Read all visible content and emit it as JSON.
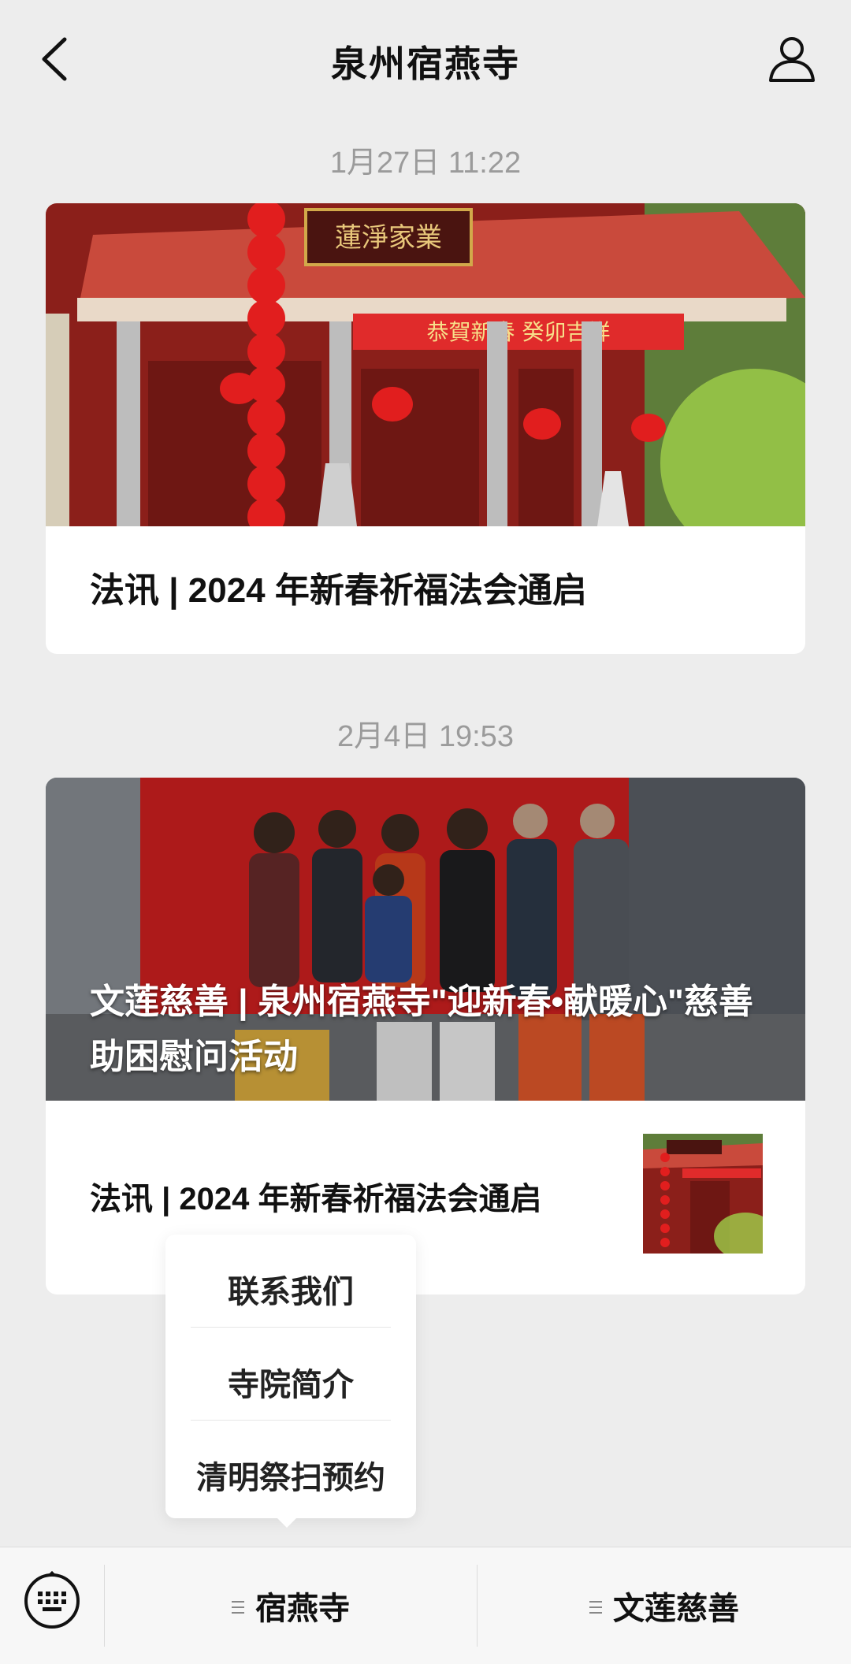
{
  "header": {
    "title": "泉州宿燕寺"
  },
  "messages": [
    {
      "time": "1月27日 11:22",
      "title": "法讯 | 2024 年新春祈福法会通启"
    },
    {
      "time": "2月4日 19:53",
      "overlay_title": "文莲慈善 | 泉州宿燕寺\"迎新春•献暖心\"慈善助困慰问活动",
      "sub_title": "法讯 | 2024 年新春祈福法会通启"
    }
  ],
  "image_text": {
    "temple_plaque": "蓮淨家業",
    "banner": "恭賀新春 癸卯吉祥"
  },
  "popup_menu": {
    "items": [
      "联系我们",
      "寺院简介",
      "清明祭扫预约"
    ]
  },
  "bottom_bar": {
    "menus": [
      "宿燕寺",
      "文莲慈善"
    ]
  }
}
